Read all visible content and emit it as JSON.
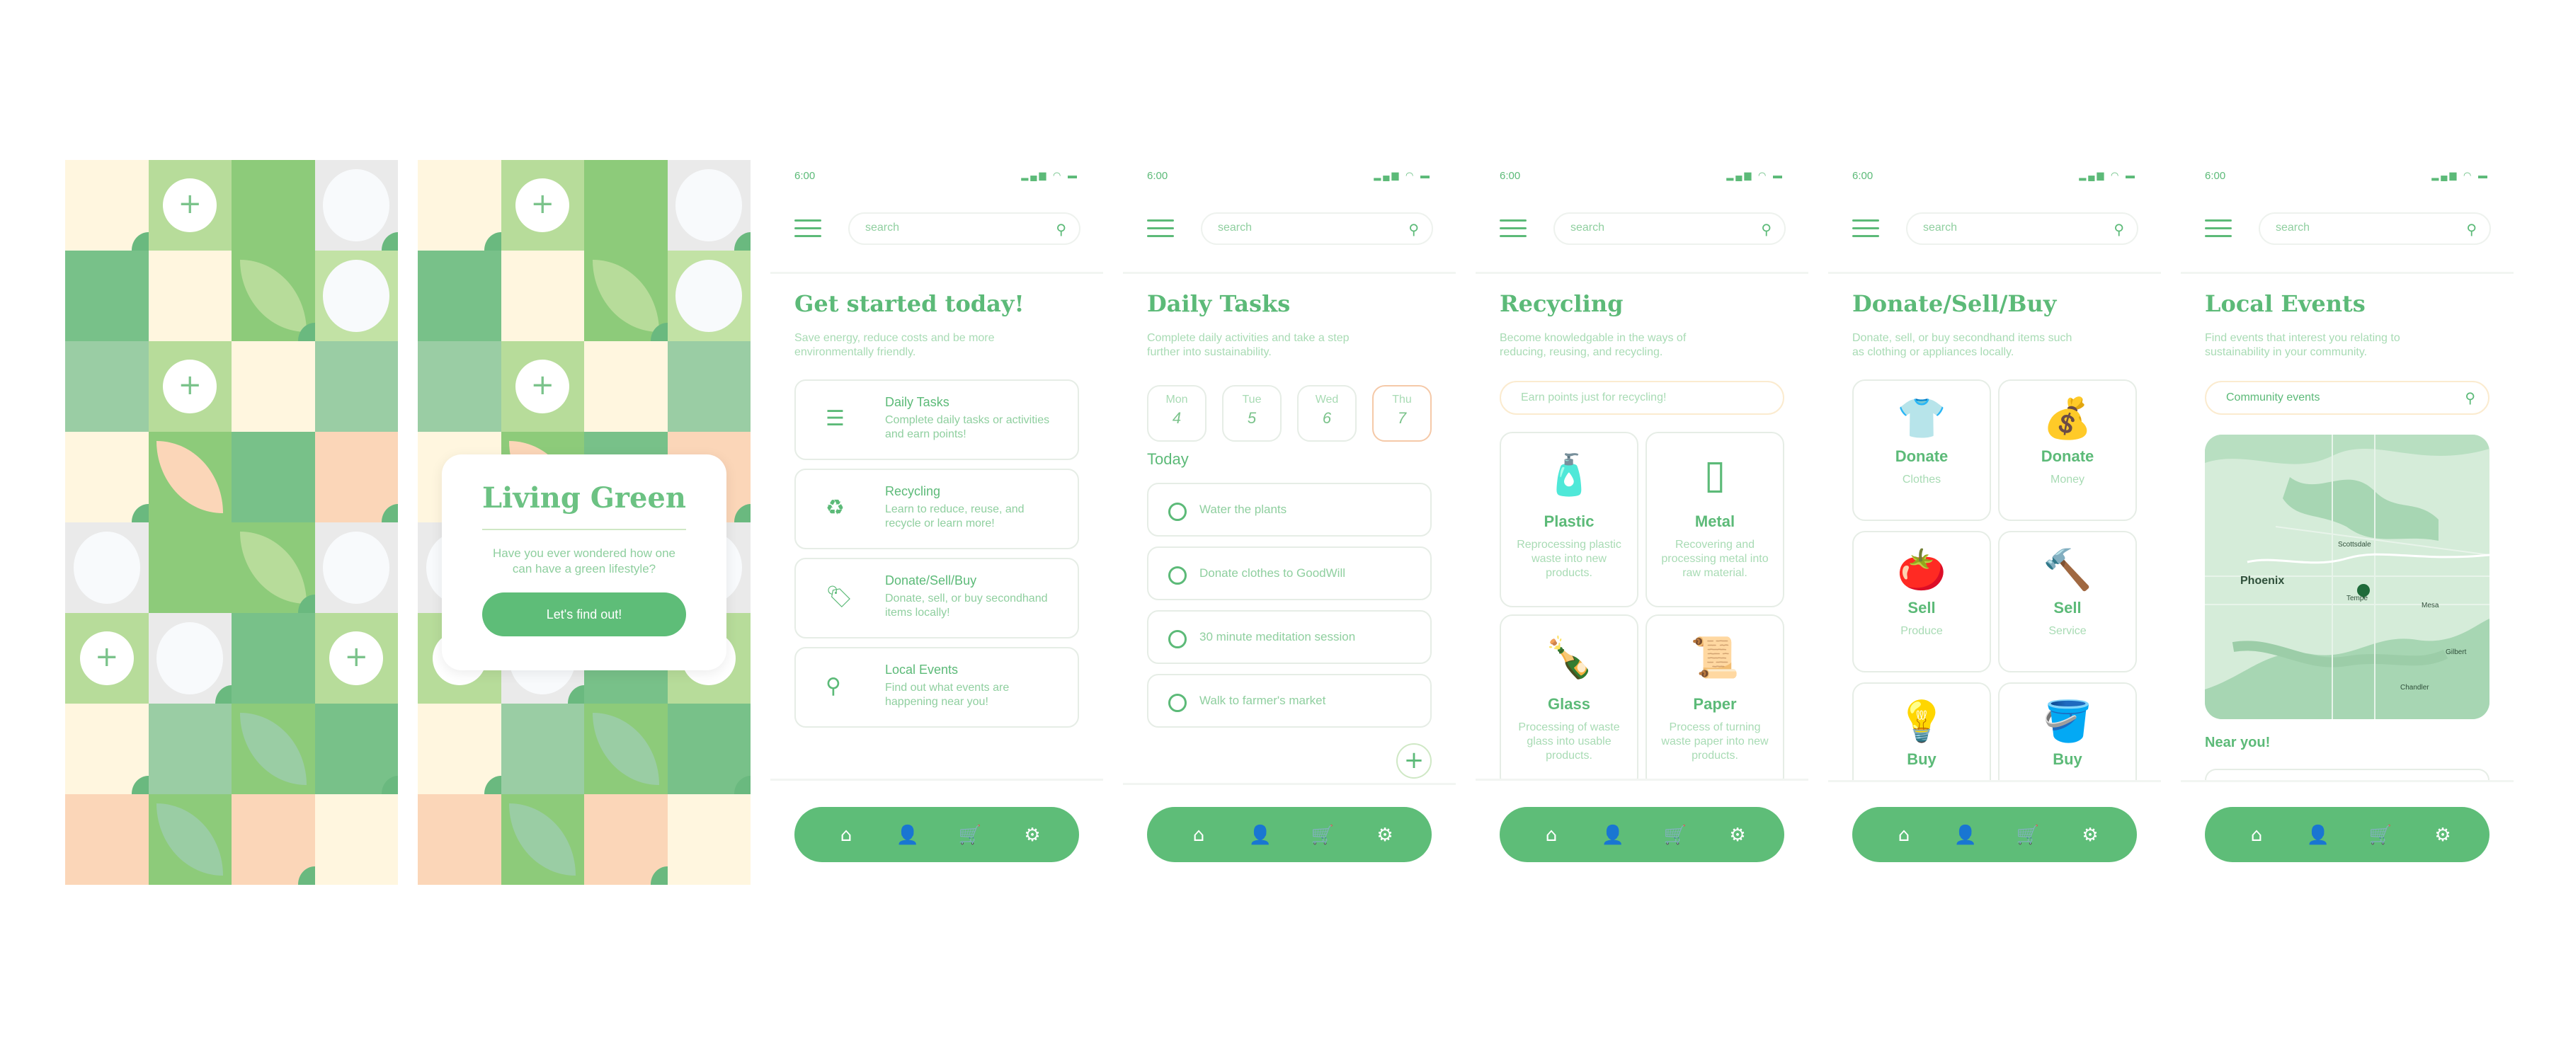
{
  "status": {
    "time": "6:00"
  },
  "search": {
    "placeholder": "search"
  },
  "colors": {
    "primary": "#5ebd78",
    "light_green": "#a8dbb4",
    "cream": "#fff6df",
    "peach": "#fbd6b8",
    "accent_border": "#f5c9a8"
  },
  "splash": {
    "title": "Living Green",
    "body": "Have you ever wondered how one can have a green lifestyle?",
    "button": "Let's find out!"
  },
  "home": {
    "title": "Get started today!",
    "subtitle": "Save energy, reduce costs and be more environmentally friendly.",
    "cards": [
      {
        "icon": "list-icon",
        "title": "Daily Tasks",
        "desc": "Complete daily tasks or activities and earn points!"
      },
      {
        "icon": "recycle-icon",
        "title": "Recycling",
        "desc": "Learn to reduce, reuse, and recycle or learn more!"
      },
      {
        "icon": "tag-icon",
        "title": "Donate/Sell/Buy",
        "desc": "Donate, sell, or buy secondhand items locally!"
      },
      {
        "icon": "location-pin-icon",
        "title": "Local Events",
        "desc": "Find out what events are happening near you!"
      }
    ]
  },
  "tasks": {
    "title": "Daily Tasks",
    "subtitle": "Complete daily activities and take a step further into sustainability.",
    "days": [
      {
        "name": "Mon",
        "date": "4"
      },
      {
        "name": "Tue",
        "date": "5"
      },
      {
        "name": "Wed",
        "date": "6"
      },
      {
        "name": "Thu",
        "date": "7"
      }
    ],
    "today_label": "Today",
    "items": [
      "Water the plants",
      "Donate clothes to GoodWill",
      "30 minute meditation session",
      "Walk to farmer's market"
    ]
  },
  "recycling": {
    "title": "Recycling",
    "subtitle": "Become knowledgable in the ways of reducing, reusing, and recycling.",
    "banner": "Earn points just for recycling!",
    "materials": [
      {
        "icon": "bottle-icon",
        "name": "Plastic",
        "desc": "Reprocessing plastic waste into new products."
      },
      {
        "icon": "can-icon",
        "name": "Metal",
        "desc": "Recovering and processing metal into raw material."
      },
      {
        "icon": "glass-bottle-icon",
        "name": "Glass",
        "desc": "Processing of waste glass into usable products."
      },
      {
        "icon": "paper-icon",
        "name": "Paper",
        "desc": "Process of turning waste paper into new products."
      }
    ]
  },
  "donate": {
    "title": "Donate/Sell/Buy",
    "subtitle": "Donate, sell, or buy secondhand items such as clothing or appliances locally.",
    "options": [
      {
        "icon": "shirt-icon",
        "name": "Donate",
        "desc": "Clothes"
      },
      {
        "icon": "money-bag-icon",
        "name": "Donate",
        "desc": "Money"
      },
      {
        "icon": "tomato-icon",
        "name": "Sell",
        "desc": "Produce"
      },
      {
        "icon": "hammer-icon",
        "name": "Sell",
        "desc": "Service"
      },
      {
        "icon": "lamp-icon",
        "name": "Buy",
        "desc": ""
      },
      {
        "icon": "bucket-icon",
        "name": "Buy",
        "desc": ""
      }
    ]
  },
  "events": {
    "title": "Local Events",
    "subtitle": "Find events that interest you relating to sustainability in your community.",
    "search_value": "Community events",
    "map_labels": [
      "Phoenix",
      "Scottsdale",
      "Tempe",
      "Mesa",
      "Gilbert",
      "Chandler"
    ],
    "near_label": "Near you!"
  },
  "nav": [
    {
      "icon": "home-icon",
      "glyph": "⌂"
    },
    {
      "icon": "user-icon",
      "glyph": "👤"
    },
    {
      "icon": "cart-icon",
      "glyph": "🛒"
    },
    {
      "icon": "gear-icon",
      "glyph": "⚙"
    }
  ]
}
